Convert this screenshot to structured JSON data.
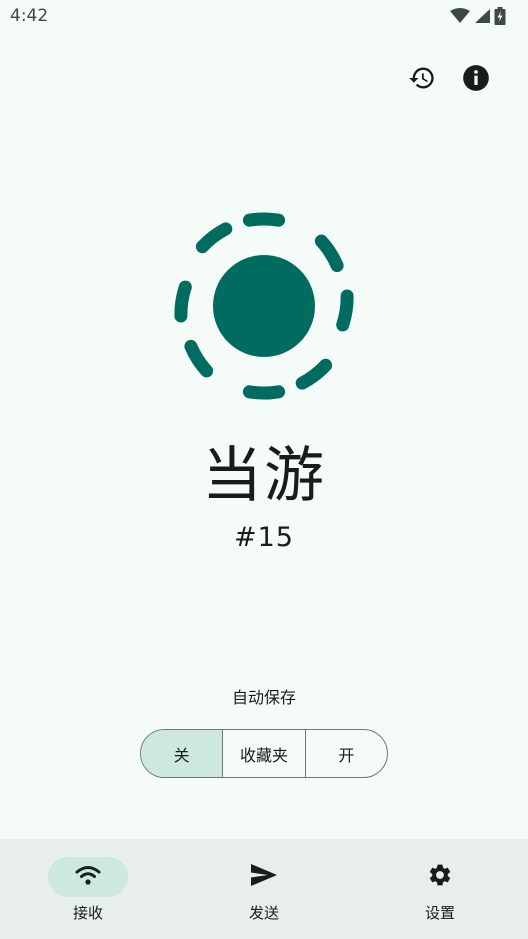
{
  "status_bar": {
    "time": "4:42"
  },
  "device": {
    "name": "当游",
    "number": "#15"
  },
  "autosave": {
    "label": "自动保存",
    "options": [
      "关",
      "收藏夹",
      "开"
    ],
    "selected": "关"
  },
  "bottom_nav": {
    "items": [
      {
        "label": "接收",
        "icon": "wifi-icon",
        "active": true
      },
      {
        "label": "发送",
        "icon": "send-icon",
        "active": false
      },
      {
        "label": "设置",
        "icon": "gear-icon",
        "active": false
      }
    ]
  },
  "colors": {
    "accent": "#006b5f",
    "background": "#f4fbf8",
    "selected_container": "#cde8e1",
    "nav_background": "#e7eeeb"
  }
}
